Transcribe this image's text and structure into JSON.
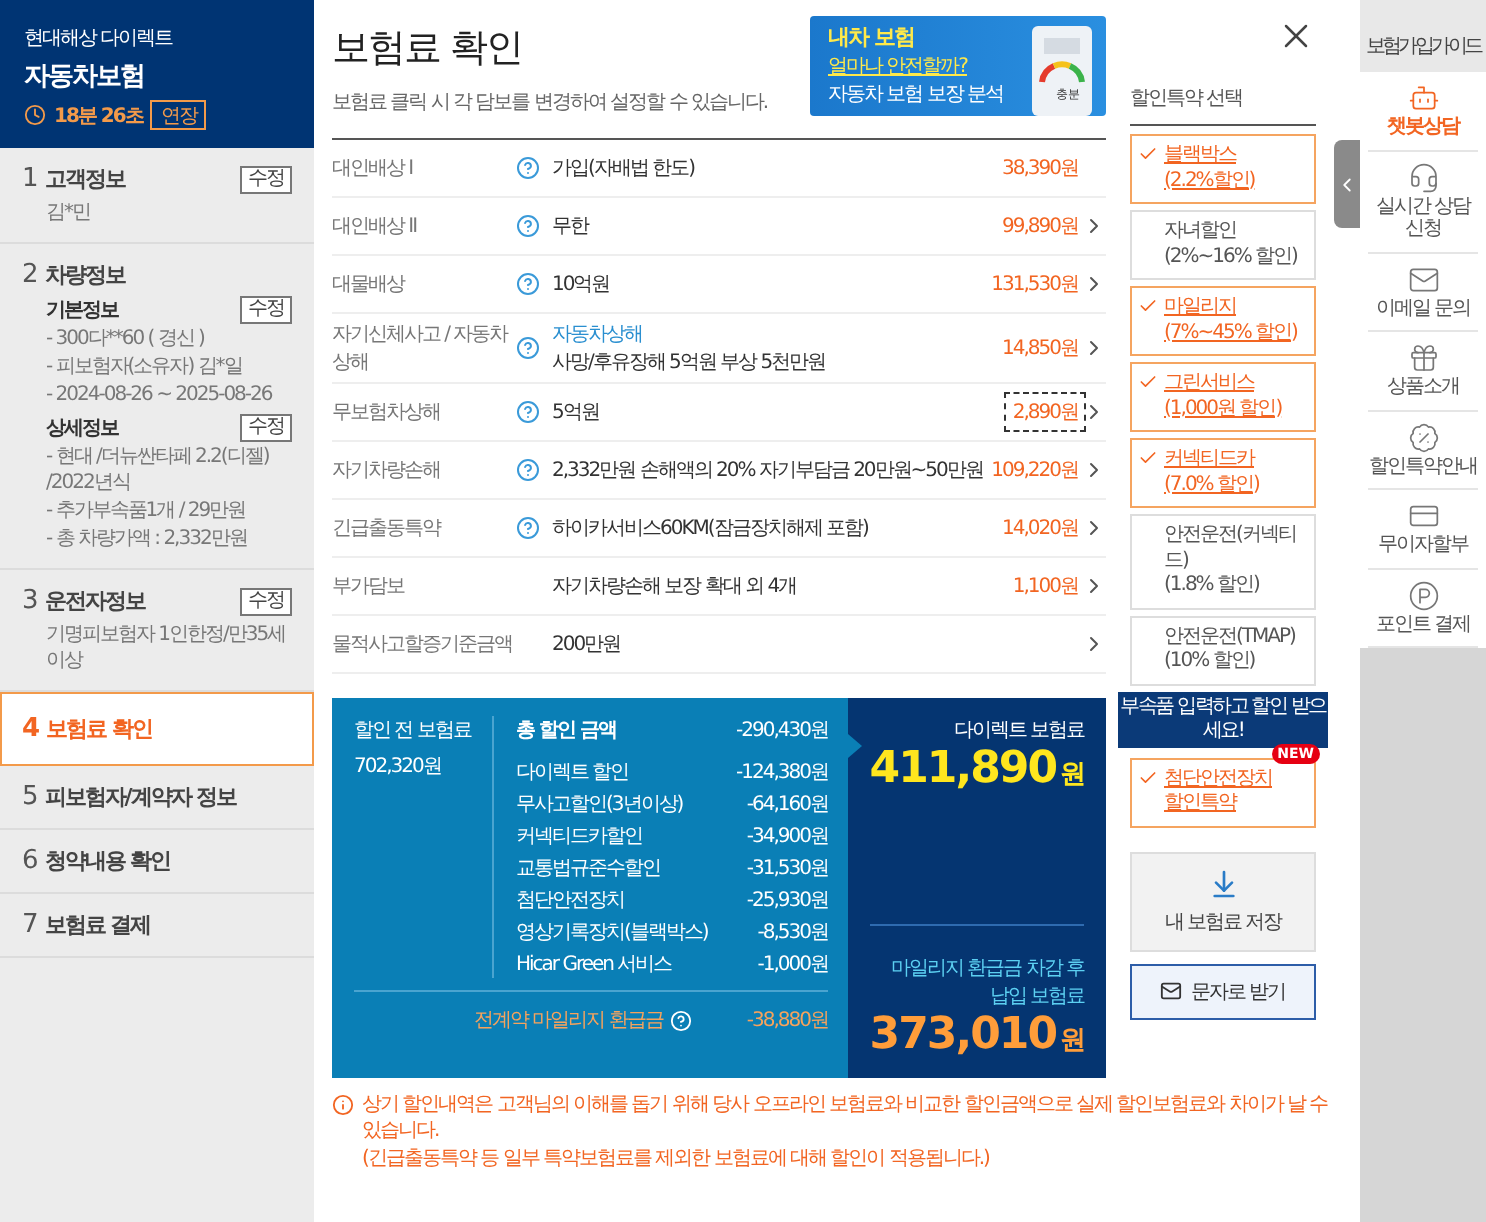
{
  "sidebar": {
    "brand": "현대해상 다이렉트",
    "product": "자동차보험",
    "timer": "18분 26초",
    "extend_button": "연장",
    "steps": [
      {
        "number": "1",
        "title": "고객정보",
        "selected": false,
        "edit": "수정",
        "sections": [
          {
            "lines": [
              "김*민"
            ]
          }
        ]
      },
      {
        "number": "2",
        "title": "차량정보",
        "selected": false,
        "sections": [
          {
            "heading": "기본정보",
            "edit": "수정",
            "lines": [
              "- 300다**60 ( 경신 )",
              "- 피보험자(소유자) 김*일",
              "- 2024-08-26 ~ 2025-08-26"
            ]
          },
          {
            "heading": "상세정보",
            "edit": "수정",
            "lines": [
              "- 현대 /더뉴싼타페 2.2(디젤) /2022년식",
              "- 추가부속품1개 / 29만원",
              "- 총 차량가액 : 2,332만원"
            ]
          }
        ]
      },
      {
        "number": "3",
        "title": "운전자정보",
        "selected": false,
        "edit": "수정",
        "sections": [
          {
            "lines": [
              "기명피보험자 1인한정/만35세이상"
            ]
          }
        ]
      },
      {
        "number": "4",
        "title": "보험료 확인",
        "selected": true
      },
      {
        "number": "5",
        "title": "피보험자/계약자 정보",
        "selected": false
      },
      {
        "number": "6",
        "title": "청약내용 확인",
        "selected": false
      },
      {
        "number": "7",
        "title": "보험료 결제",
        "selected": false
      }
    ]
  },
  "header": {
    "title": "보험료 확인",
    "subtitle": "보험료 클릭 시 각 담보를 변경하여 설정할 수 있습니다.",
    "banner": {
      "line1": "내차 보험",
      "line2": "얼마나 안전할까?",
      "line3": "자동차 보험 보장 분석",
      "gauge_label": "충분"
    }
  },
  "coverages": [
    {
      "name": "대인배상 I",
      "help": true,
      "value": "가입(자배법 한도)",
      "price": "38,390원",
      "arrow": false,
      "focused": false
    },
    {
      "name": "대인배상 II",
      "help": true,
      "value": "무한",
      "price": "99,890원",
      "arrow": true,
      "focused": false
    },
    {
      "name": "대물배상",
      "help": true,
      "value": "10억원",
      "price": "131,530원",
      "arrow": true,
      "focused": false
    },
    {
      "name": "자기신체사고 / 자동차상해",
      "help": true,
      "sub_value": "자동차상해",
      "value": "사망/후유장해 5억원 부상 5천만원",
      "price": "14,850원",
      "arrow": true,
      "focused": false
    },
    {
      "name": "무보험차상해",
      "help": true,
      "value": "5억원",
      "price": "2,890원",
      "arrow": true,
      "focused": true
    },
    {
      "name": "자기차량손해",
      "help": true,
      "value": "2,332만원 손해액의 20% 자기부담금 20만원~50만원",
      "price": "109,220원",
      "arrow": true,
      "focused": false
    },
    {
      "name": "긴급출동특약",
      "help": true,
      "value": "하이카서비스60KM(잠금장치해제 포함)",
      "price": "14,020원",
      "arrow": true,
      "focused": false
    },
    {
      "name": "부가담보",
      "help": false,
      "value": "자기차량손해 보장 확대 외 4개",
      "price": "1,100원",
      "arrow": true,
      "focused": false
    },
    {
      "name": "물적사고할증기준금액",
      "help": false,
      "value": "200만원",
      "arrow": true
    }
  ],
  "summary": {
    "before_label": "할인 전 보험료",
    "before_amount": "702,320원",
    "total_label": "총 할인 금액",
    "total_amount": "-290,430원",
    "items": [
      {
        "label": "다이렉트 할인",
        "amount": "-124,380원"
      },
      {
        "label": "무사고할인(3년이상)",
        "amount": "-64,160원"
      },
      {
        "label": "커넥티드카할인",
        "amount": "-34,900원"
      },
      {
        "label": "교통법규준수할인",
        "amount": "-31,530원"
      },
      {
        "label": "첨단안전장치",
        "amount": "-25,930원"
      },
      {
        "label": "영상기록장치(블랙박스)",
        "amount": "-8,530원"
      },
      {
        "label": "Hicar Green 서비스",
        "amount": "-1,000원"
      }
    ],
    "mileage_label": "전계약 마일리지 환급금",
    "mileage_amount": "-38,880원",
    "direct_label": "다이렉트 보험료",
    "direct_amount": "411,890",
    "direct_unit": "원",
    "after_label": [
      "마일리지 환급금 차감 후",
      "납입 보험료"
    ],
    "after_amount": "373,010",
    "after_unit": "원"
  },
  "discounts": {
    "title": "할인특약 선택",
    "tooltip": "부속품 입력하고 할인 받으세요!",
    "items": [
      {
        "name": "블랙박스",
        "rate": "(2.2%할인)",
        "selected": true
      },
      {
        "name": "자녀할인",
        "rate": "(2%~16% 할인)",
        "selected": false
      },
      {
        "name": "마일리지",
        "rate": "(7%~45% 할인)",
        "selected": true
      },
      {
        "name": "그린서비스",
        "rate": "(1,000원 할인)",
        "selected": true
      },
      {
        "name": "커넥티드카",
        "rate": "(7.0% 할인)",
        "selected": true
      },
      {
        "name": "안전운전(커넥티드)",
        "rate": "(1.8% 할인)",
        "selected": false
      },
      {
        "name": "안전운전(TMAP)",
        "rate": "(10% 할인)",
        "selected": false
      },
      {
        "name": "첨단안전장치",
        "rate": "할인특약",
        "selected": true,
        "badge": "NEW"
      }
    ]
  },
  "actions": {
    "save": "내 보험료 저장",
    "sms": "문자로 받기"
  },
  "notice": [
    "상기 할인내역은 고객님의 이해를 돕기 위해 당사 오프라인 보험료와 비교한 할인금액으로 실제 할인보험료와 차이가 날 수 있습니다.",
    "(긴급출동특약 등 일부 특약보험료를 제외한 보험료에 대해 할인이 적용됩니다.)"
  ],
  "guide": {
    "title": "보험가입가이드",
    "items": [
      {
        "kind": "chatbot",
        "label": "챗봇상담",
        "highlighted": true
      },
      {
        "kind": "consult",
        "label": "실시간 상담신청",
        "highlighted": false
      },
      {
        "kind": "email",
        "label": "이메일 문의",
        "highlighted": false
      },
      {
        "kind": "product",
        "label": "상품소개",
        "highlighted": false
      },
      {
        "kind": "discount",
        "label": "할인특약안내",
        "highlighted": false
      },
      {
        "kind": "installment",
        "label": "무이자할부",
        "highlighted": false
      },
      {
        "kind": "point",
        "label": "포인트 결제",
        "highlighted": false
      }
    ]
  }
}
